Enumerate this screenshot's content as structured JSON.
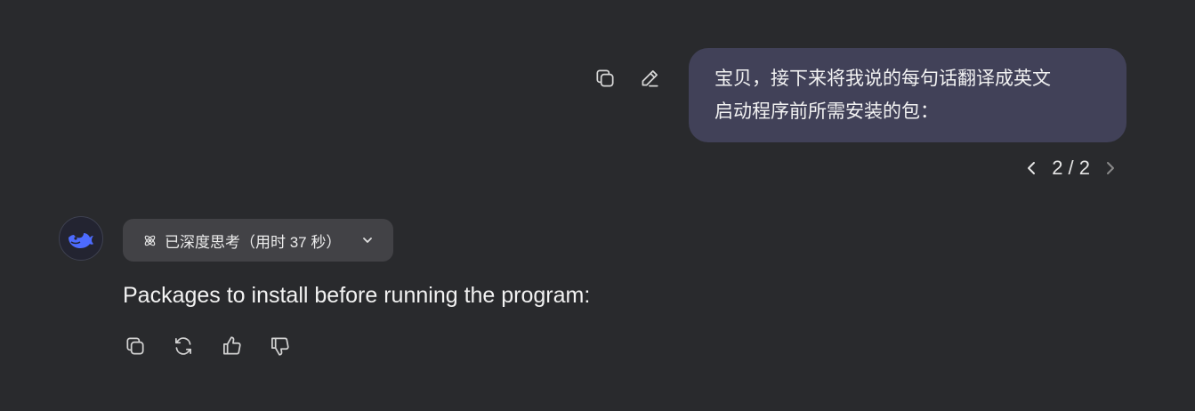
{
  "user_message": {
    "lines": [
      "宝贝，接下来将我说的每句话翻译成英文",
      "启动程序前所需安装的包："
    ],
    "copy_icon": "copy-icon",
    "edit_icon": "edit-icon"
  },
  "pager": {
    "text": "2 / 2",
    "prev_icon": "chevron-left-icon",
    "next_icon": "chevron-right-icon"
  },
  "assistant": {
    "avatar_icon": "whale-logo-icon",
    "thinking_label": "已深度思考（用时 37 秒）",
    "thinking_icon": "atom-icon",
    "expand_icon": "chevron-down-icon",
    "answer": "Packages to install before running the program:",
    "actions": [
      "copy-icon",
      "regenerate-icon",
      "thumbs-up-icon",
      "thumbs-down-icon"
    ]
  },
  "colors": {
    "background": "#292a2d",
    "user_bubble": "#414158",
    "think_chip": "#424246",
    "brand_blue": "#4d6bfe"
  }
}
